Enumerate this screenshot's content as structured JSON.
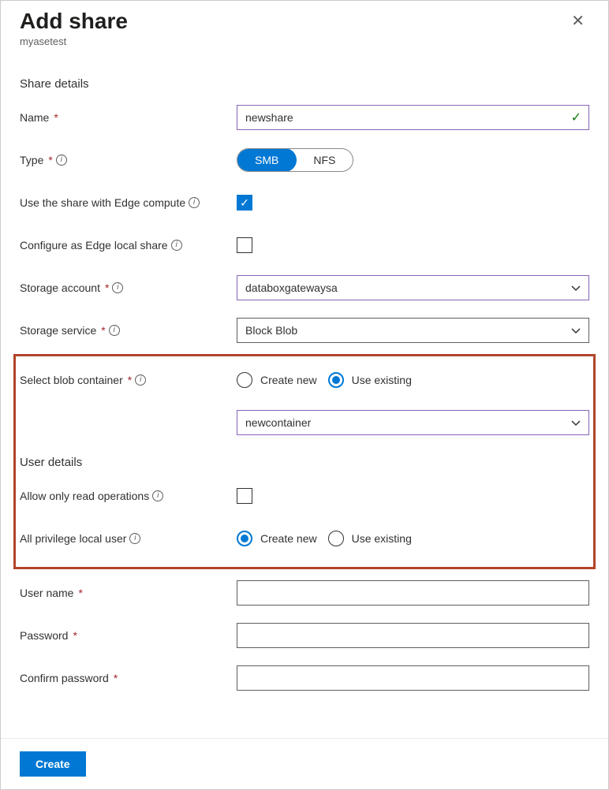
{
  "header": {
    "title": "Add share",
    "subtitle": "myasetest"
  },
  "sections": {
    "share_details": "Share details",
    "user_details": "User details"
  },
  "fields": {
    "name": {
      "label": "Name",
      "value": "newshare"
    },
    "type": {
      "label": "Type",
      "option_smb": "SMB",
      "option_nfs": "NFS",
      "selected": "SMB"
    },
    "edge_compute": {
      "label": "Use the share with Edge compute",
      "checked": true
    },
    "edge_local": {
      "label": "Configure as Edge local share",
      "checked": false
    },
    "storage_account": {
      "label": "Storage account",
      "value": "databoxgatewaysa"
    },
    "storage_service": {
      "label": "Storage service",
      "value": "Block Blob"
    },
    "blob_container": {
      "label": "Select blob container",
      "option_create": "Create new",
      "option_existing": "Use existing",
      "selected": "Use existing",
      "value": "newcontainer"
    },
    "read_only": {
      "label": "Allow only read operations",
      "checked": false
    },
    "local_user": {
      "label": "All privilege local user",
      "option_create": "Create new",
      "option_existing": "Use existing",
      "selected": "Create new"
    },
    "username": {
      "label": "User name",
      "value": ""
    },
    "password": {
      "label": "Password",
      "value": ""
    },
    "confirm_password": {
      "label": "Confirm password",
      "value": ""
    }
  },
  "footer": {
    "create_label": "Create"
  }
}
